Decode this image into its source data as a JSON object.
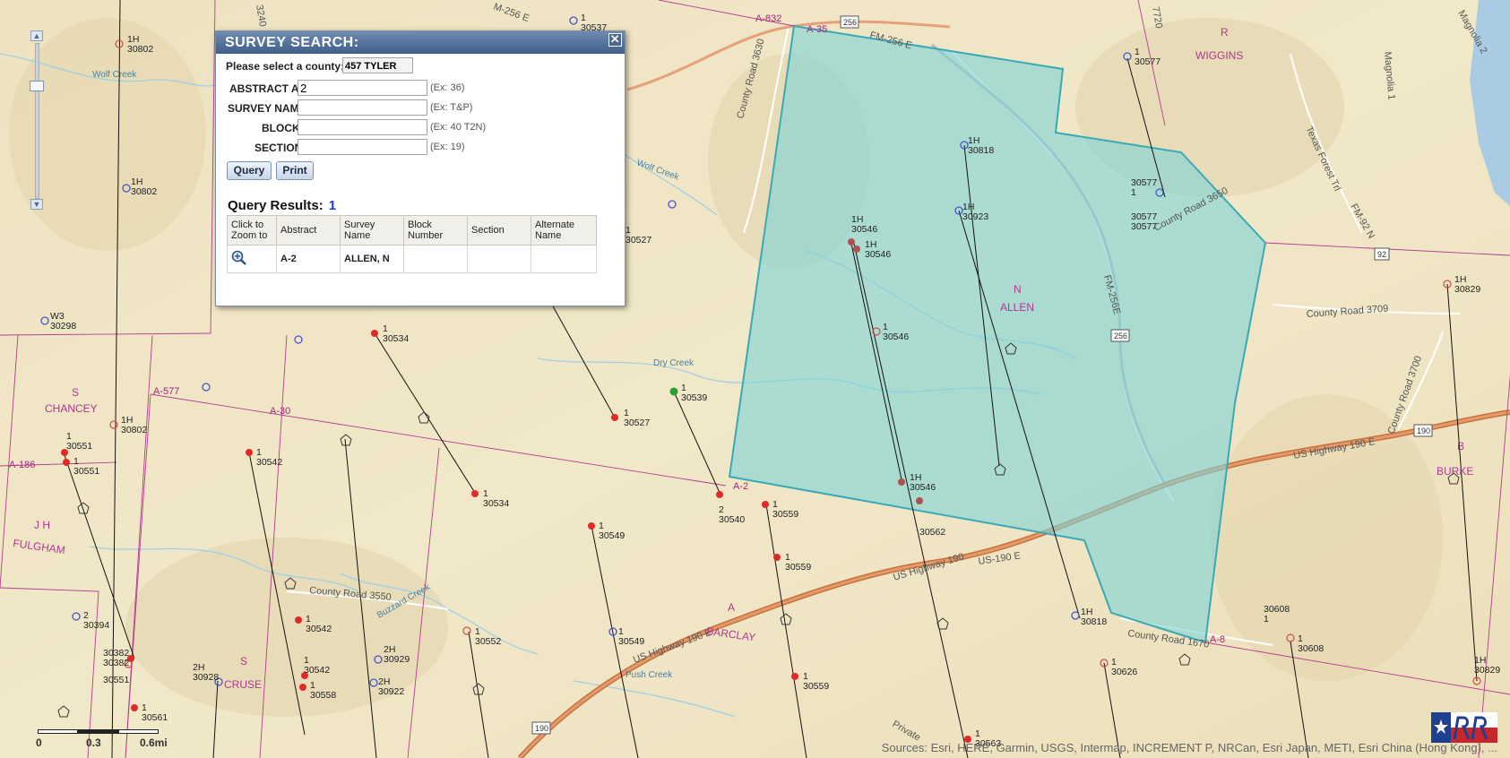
{
  "dialog": {
    "title": "SURVEY SEARCH:",
    "close_label": "✕",
    "county_label": "Please select a county:",
    "county_value": "457 TYLER",
    "fields": [
      {
        "label": "ABSTRACT A-",
        "value": "2",
        "hint": "(Ex: 36)"
      },
      {
        "label": "SURVEY NAME",
        "value": "",
        "hint": "(Ex: T&P)"
      },
      {
        "label": "BLOCK",
        "value": "",
        "hint": "(Ex: 40 T2N)"
      },
      {
        "label": "SECTION",
        "value": "",
        "hint": "(Ex: 19)"
      }
    ],
    "query_label": "Query",
    "print_label": "Print",
    "results_title": "Query Results:",
    "results_count": "1",
    "table": {
      "headers": [
        "Click to Zoom to",
        "Abstract",
        "Survey Name",
        "Block Number",
        "Section",
        "Alternate Name"
      ],
      "rows": [
        {
          "zoom_icon": "zoom-in-icon",
          "abstract": "A-2",
          "survey_name": "ALLEN, N",
          "block": "",
          "section": "",
          "alternate": ""
        }
      ]
    }
  },
  "map": {
    "highlight_color": "#7fd3d6",
    "labels": {
      "a832": "A-832",
      "a35": "A-35",
      "fm256e_top": "FM-256 E",
      "cr3630": "County Road 3630",
      "wiggins_r": "R",
      "wiggins": "WIGGINS",
      "magnolia1": "Magnolia 1",
      "magnolia2": "Magnolia 2",
      "txforest": "Texas Forest Trl",
      "fm92n": "FM-92 N",
      "cr3650": "County Road 3650",
      "cr3709": "County Road 3709",
      "cr3700": "County Road 3700",
      "n_allen": "N",
      "allen": "ALLEN",
      "fm256e_mid": "FM-256E",
      "dry_creek": "Dry Creek",
      "wolf_creek": "Wolf Creek",
      "wolf_creek2": "Wolf Creek",
      "s_chancey": "S",
      "chancey": "CHANCEY",
      "a577": "A-577",
      "a30": "A-30",
      "a186": "A-186",
      "jh": "J H",
      "fulgham": "FULGHAM",
      "cr3550": "County Road 3550",
      "buzzard": "Buzzard Creek",
      "a2": "A-2",
      "a8": "A-8",
      "cr1670": "County Road 1670",
      "us190e_right": "US Highway 190 E",
      "us190_mid": "US Highway 190",
      "us190e_mid": "US-190 E",
      "us190e_left": "US Highway 190 E",
      "a_barclay": "A",
      "barclay": "BARCLAY",
      "s_cruse": "S",
      "cruse": "CRUSE",
      "push_creek": "Push Creek",
      "b_burke": "B",
      "burke": "BURKE",
      "private": "Private",
      "shield_256a": "256",
      "shield_256b": "256",
      "shield_92": "92",
      "shield_190a": "190",
      "shield_190b": "190",
      "m256e": "M-256 E",
      "n7720": "7720",
      "n3240": "3240"
    },
    "wells": [
      {
        "n": "1H",
        "id": "30802"
      },
      {
        "n": "1H",
        "id": "30802"
      },
      {
        "n": "W3",
        "id": "30298"
      },
      {
        "n": "1",
        "id": "30537"
      },
      {
        "n": "1",
        "id": "30577"
      },
      {
        "n": "1H",
        "id": "30818"
      },
      {
        "n": "1H",
        "id": "30923"
      },
      {
        "n": "30577",
        "id": "1"
      },
      {
        "n": "30577",
        "id": "30577"
      },
      {
        "n": "1H",
        "id": "30546"
      },
      {
        "n": "1H",
        "id": "30546"
      },
      {
        "n": "1",
        "id": "30546"
      },
      {
        "n": "1H",
        "id": "30829"
      },
      {
        "n": "1",
        "id": "30534"
      },
      {
        "n": "1",
        "id": "30527"
      },
      {
        "n": "1",
        "id": "30539"
      },
      {
        "n": "1",
        "id": "30527"
      },
      {
        "n": "1H",
        "id": "30802"
      },
      {
        "n": "1",
        "id": "30551"
      },
      {
        "n": "1",
        "id": "30551"
      },
      {
        "n": "1",
        "id": "30542"
      },
      {
        "n": "1",
        "id": "30534"
      },
      {
        "n": "2",
        "id": "30540"
      },
      {
        "n": "1",
        "id": "30559"
      },
      {
        "n": "1H",
        "id": "30546"
      },
      {
        "n": "",
        "id": "30562"
      },
      {
        "n": "1",
        "id": "30549"
      },
      {
        "n": "1",
        "id": "30559"
      },
      {
        "n": "2",
        "id": "30394"
      },
      {
        "n": "1",
        "id": "30542"
      },
      {
        "n": "1",
        "id": "30542"
      },
      {
        "n": "1",
        "id": "30558"
      },
      {
        "n": "2H",
        "id": "30929"
      },
      {
        "n": "2H",
        "id": "30922"
      },
      {
        "n": "2H",
        "id": "30928"
      },
      {
        "n": "1",
        "id": "30561"
      },
      {
        "n": "1",
        "id": "30552"
      },
      {
        "n": "1",
        "id": "30549"
      },
      {
        "n": "1",
        "id": "30559"
      },
      {
        "n": "1H",
        "id": "30818"
      },
      {
        "n": "1",
        "id": "30626"
      },
      {
        "n": "30608",
        "id": "1"
      },
      {
        "n": "1",
        "id": "30608"
      },
      {
        "n": "1H",
        "id": "30829"
      },
      {
        "n": "30382",
        "id": "30382"
      },
      {
        "n": "30551",
        "id": ""
      },
      {
        "n": "1",
        "id": "30563"
      },
      {
        "n": "1",
        "id": ""
      },
      {
        "n": "1",
        "id": ""
      }
    ]
  },
  "scale": {
    "l0": "0",
    "l1": "0.3",
    "l2": "0.6mi"
  },
  "attribution": "Sources: Esri, HERE, Garmin, USGS, Intermap, INCREMENT P, NRCan, Esri Japan, METI, Esri China (Hong Kong), ..."
}
